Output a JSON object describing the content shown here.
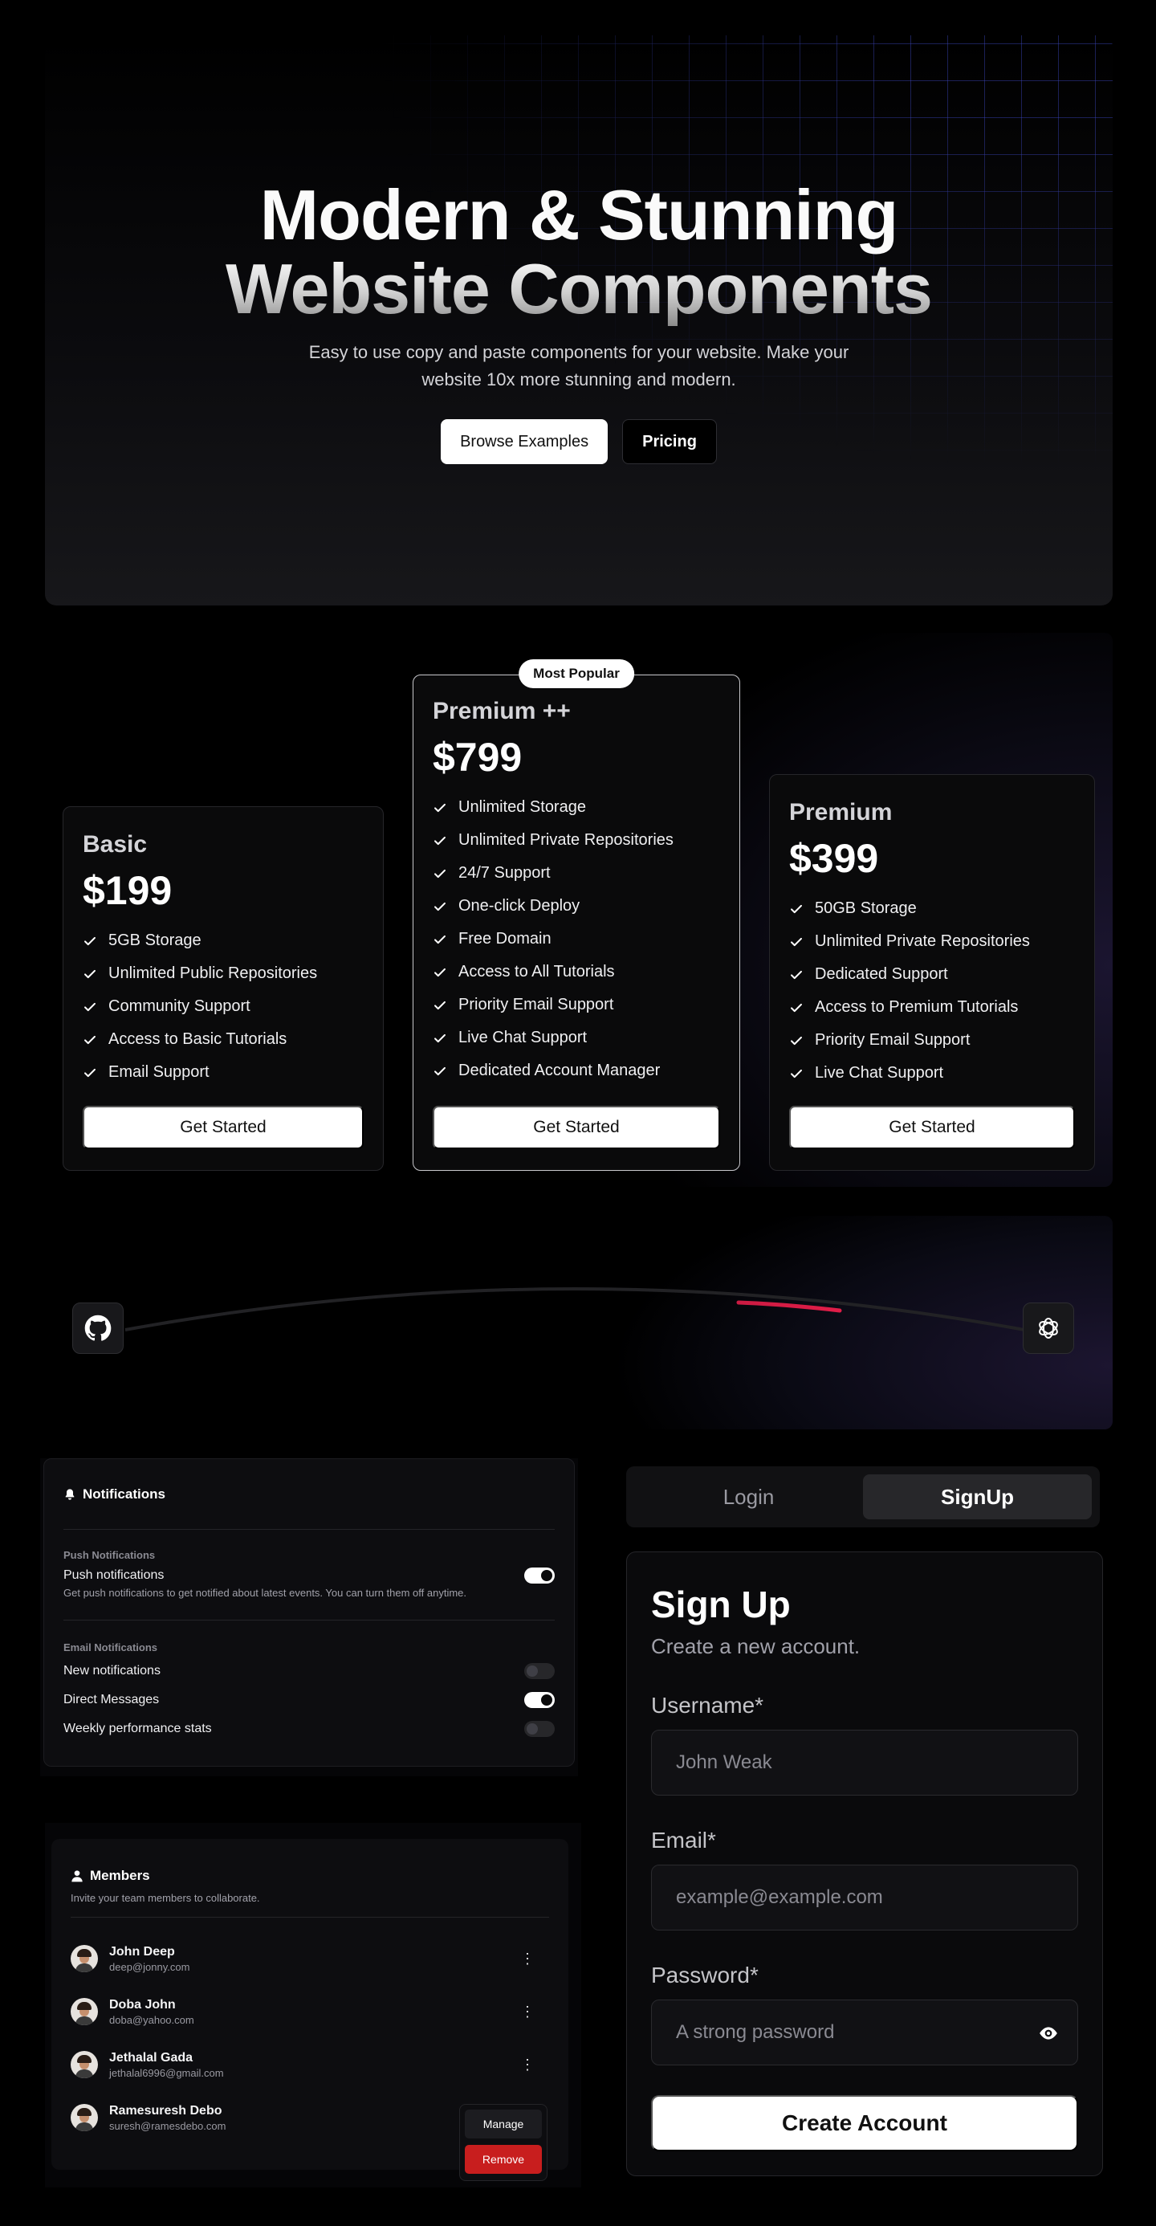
{
  "hero": {
    "title_line1": "Modern & Stunning",
    "title_line2": "Website Components",
    "subtitle": "Easy to use copy and paste components for your website. Make your website 10x more stunning and modern.",
    "browse_label": "Browse Examples",
    "pricing_label": "Pricing"
  },
  "pricing": {
    "badge": "Most Popular",
    "plans": [
      {
        "name": "Basic",
        "price": "$199",
        "features": [
          "5GB Storage",
          "Unlimited Public Repositories",
          "Community Support",
          "Access to Basic Tutorials",
          "Email Support"
        ],
        "cta": "Get Started"
      },
      {
        "name": "Premium ++",
        "price": "$799",
        "features": [
          "Unlimited Storage",
          "Unlimited Private Repositories",
          "24/7 Support",
          "One-click Deploy",
          "Free Domain",
          "Access to All Tutorials",
          "Priority Email Support",
          "Live Chat Support",
          "Dedicated Account Manager"
        ],
        "cta": "Get Started"
      },
      {
        "name": "Premium",
        "price": "$399",
        "features": [
          "50GB Storage",
          "Unlimited Private Repositories",
          "Dedicated Support",
          "Access to Premium Tutorials",
          "Priority Email Support",
          "Live Chat Support"
        ],
        "cta": "Get Started"
      }
    ]
  },
  "beam": {
    "left_icon": "github-icon",
    "right_icon": "openai-icon",
    "beam_color": "#e11d48"
  },
  "notifications": {
    "title": "Notifications",
    "push_section": "Push Notifications",
    "push_label": "Push notifications",
    "push_desc": "Get push notifications to get notified about latest events. You can turn them off anytime.",
    "push_on": true,
    "email_section": "Email Notifications",
    "email_items": [
      {
        "label": "New notifications",
        "on": false
      },
      {
        "label": "Direct Messages",
        "on": true
      },
      {
        "label": "Weekly performance stats",
        "on": false
      }
    ]
  },
  "members": {
    "title": "Members",
    "subtitle": "Invite your team members to collaborate.",
    "list": [
      {
        "name": "John Deep",
        "email": "deep@jonny.com"
      },
      {
        "name": "Doba John",
        "email": "doba@yahoo.com"
      },
      {
        "name": "Jethalal Gada",
        "email": "jethalal6996@gmail.com"
      },
      {
        "name": "Ramesuresh Debo",
        "email": "suresh@ramesdebo.com"
      }
    ],
    "menu": {
      "manage": "Manage",
      "remove": "Remove"
    }
  },
  "auth": {
    "tabs": [
      "Login",
      "SignUp"
    ],
    "active_tab": "SignUp",
    "title": "Sign Up",
    "subtitle": "Create a new account.",
    "username_label": "Username*",
    "username_placeholder": "John Weak",
    "email_label": "Email*",
    "email_placeholder": "example@example.com",
    "password_label": "Password*",
    "password_placeholder": "A strong password",
    "submit": "Create Account"
  }
}
